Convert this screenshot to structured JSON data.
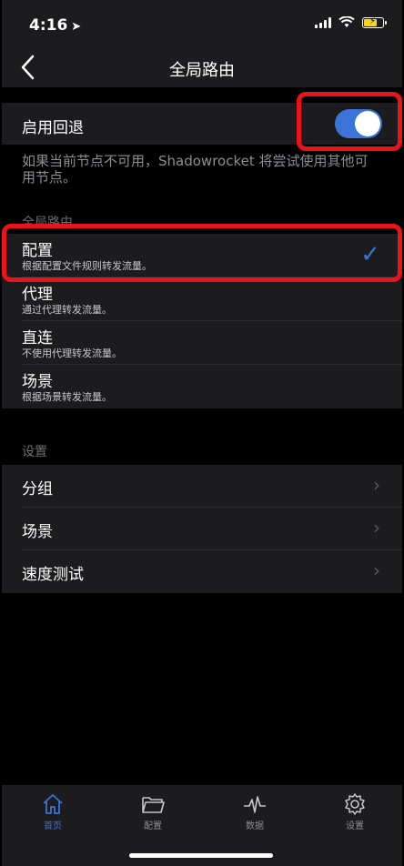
{
  "status_bar": {
    "time": "4:16",
    "location_icon": "location-arrow-icon"
  },
  "nav": {
    "title": "全局路由",
    "back_icon": "chevron-left-icon"
  },
  "fallback": {
    "label": "启用回退",
    "enabled": true,
    "note": "如果当前节点不可用，Shadowrocket 将尝试使用其他可用节点。"
  },
  "routing": {
    "header": "全局路由",
    "items": [
      {
        "title": "配置",
        "subtitle": "根据配置文件规则转发流量。",
        "selected": true
      },
      {
        "title": "代理",
        "subtitle": "通过代理转发流量。",
        "selected": false
      },
      {
        "title": "直连",
        "subtitle": "不使用代理转发流量。",
        "selected": false
      },
      {
        "title": "场景",
        "subtitle": "根据场景转发流量。",
        "selected": false
      }
    ]
  },
  "settings": {
    "header": "设置",
    "items": [
      {
        "title": "分组"
      },
      {
        "title": "场景"
      },
      {
        "title": "速度测试"
      }
    ]
  },
  "tabbar": {
    "items": [
      {
        "label": "首页",
        "icon": "home-icon",
        "active": true
      },
      {
        "label": "配置",
        "icon": "folder-icon",
        "active": false
      },
      {
        "label": "数据",
        "icon": "waveform-icon",
        "active": false
      },
      {
        "label": "设置",
        "icon": "gear-icon",
        "active": false
      }
    ]
  },
  "colors": {
    "accent": "#3a74d6",
    "highlight": "#e8141a",
    "background": "#000000",
    "cell": "#1c1c1e"
  }
}
